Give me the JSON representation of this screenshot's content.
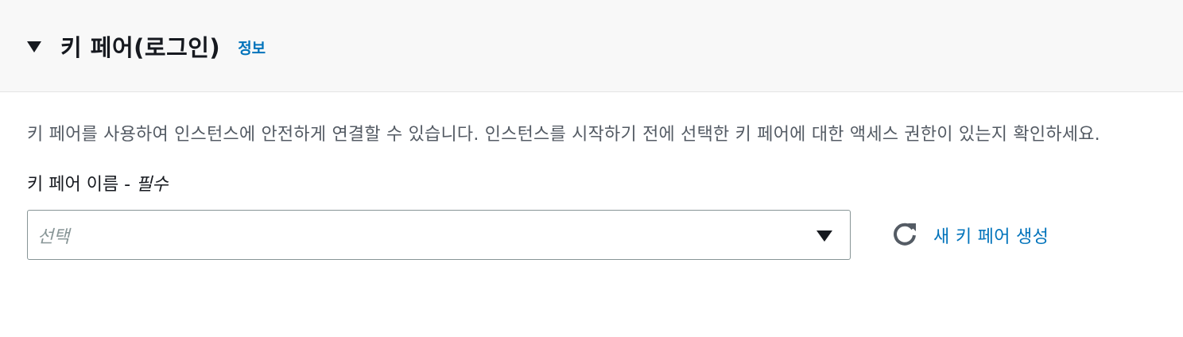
{
  "header": {
    "title": "키 페어(로그인)",
    "info_link": "정보",
    "collapse_icon": "caret-down-icon"
  },
  "body": {
    "description": "키 페어를 사용하여 인스턴스에 안전하게 연결할 수 있습니다. 인스턴스를 시작하기 전에 선택한 키 페어에 대한 액세스 권한이 있는지 확인하세요.",
    "field": {
      "label": "키 페어 이름 - ",
      "required_label": "필수",
      "placeholder": "선택",
      "dropdown_icon": "caret-down-icon"
    },
    "refresh_icon": "refresh-icon",
    "create_link": "새 키 페어 생성"
  },
  "colors": {
    "link": "#0073bb",
    "header_bg": "#f8f8f8",
    "text": "#16191f",
    "muted_text": "#545b64",
    "border": "#879596"
  }
}
